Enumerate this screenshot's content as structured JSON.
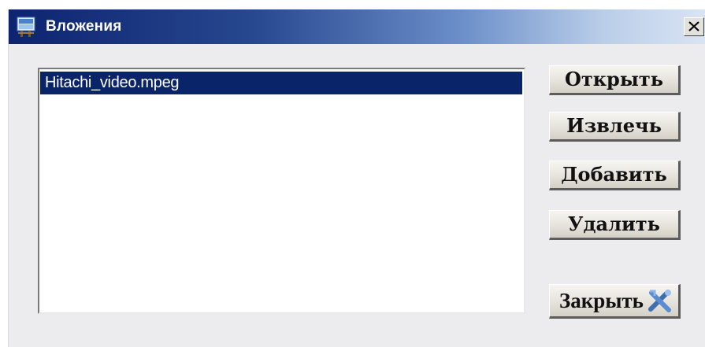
{
  "window": {
    "title": "Вложения",
    "icon": "attachments-app-icon",
    "close_icon": "close-x-icon"
  },
  "attachments": {
    "items": [
      {
        "name": "Hitachi_video.mpeg",
        "selected": true
      }
    ]
  },
  "buttons": {
    "open": "Открыть",
    "extract": "Извлечь",
    "add": "Добавить",
    "delete": "Удалить",
    "close": "Закрыть",
    "close_icon": "tools-cross-icon"
  },
  "colors": {
    "title_start": "#0d2470",
    "title_end": "#d9e4f3",
    "selection": "#0a246a",
    "window_bg": "#ecebee"
  }
}
